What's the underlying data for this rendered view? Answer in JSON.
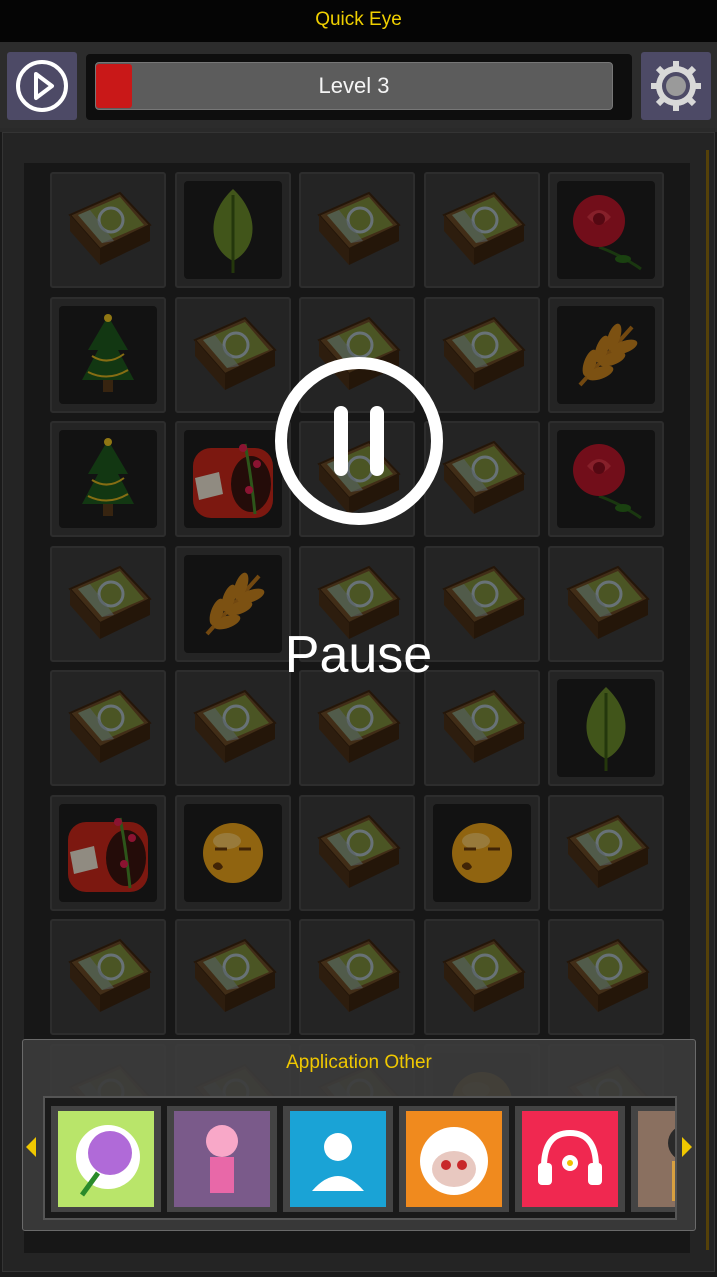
{
  "app": {
    "title": "Quick Eye"
  },
  "header": {
    "level_label": "Level 3",
    "progress": 0.07
  },
  "icons": {
    "play": "play-icon",
    "settings": "gear-icon",
    "pause": "pause-icon"
  },
  "board": {
    "rows": [
      [
        "book",
        "leaf",
        "book",
        "book",
        "rose"
      ],
      [
        "tree",
        "book",
        "book",
        "book",
        "wheat"
      ],
      [
        "tree",
        "gift",
        "book",
        "book",
        "rose"
      ],
      [
        "book",
        "wheat",
        "book",
        "book",
        "book"
      ],
      [
        "book",
        "book",
        "book",
        "book",
        "leaf"
      ],
      [
        "gift",
        "smiley",
        "book",
        "smiley",
        "book"
      ],
      [
        "book",
        "book",
        "book",
        "book",
        "book"
      ],
      [
        "book",
        "book",
        "book",
        "smiley",
        "book"
      ]
    ]
  },
  "overlay": {
    "pause_text": "Pause"
  },
  "ads": {
    "title": "Application Other",
    "items": [
      {
        "name": "rose-app-icon",
        "color": "#b9e56a"
      },
      {
        "name": "anime-girl-app-icon",
        "color": "#7a5a8a"
      },
      {
        "name": "contact-app-icon",
        "color": "#1aa3d6"
      },
      {
        "name": "sheep-app-icon",
        "color": "#f08a1e"
      },
      {
        "name": "music-headphones-app-icon",
        "color": "#f02850"
      },
      {
        "name": "anime-girl2-app-icon",
        "color": "#8a7060"
      }
    ]
  },
  "colors": {
    "accent": "#f0d000",
    "level_fill": "#c91818"
  }
}
